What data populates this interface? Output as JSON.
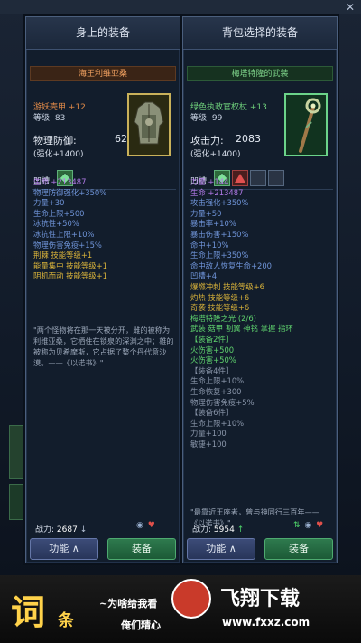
{
  "left": {
    "title": "身上的装备",
    "item_name": "海王利维亚桑",
    "item_type": "游妖壳甲 +12",
    "level": "等级: 83",
    "main_stat_label": "物理防御:",
    "main_stat_value": "6254",
    "enhance": "(强化+1400)",
    "sockets_label": "凹槽:",
    "lines": [
      {
        "text": "生命 +213487",
        "cls": "c-purple"
      },
      {
        "text": "物理防御强化+350%",
        "cls": "c-blue"
      },
      {
        "text": "力量+30",
        "cls": "c-blue"
      },
      {
        "text": "生命上限+500",
        "cls": "c-blue"
      },
      {
        "text": "冰抗性+50%",
        "cls": "c-blue"
      },
      {
        "text": "冰抗性上限+10%",
        "cls": "c-blue"
      },
      {
        "text": "物理伤害免疫+15%",
        "cls": "c-blue"
      },
      {
        "text": "荆棘 技能等级+1",
        "cls": "c-gold"
      },
      {
        "text": "能量集中 技能等级+1",
        "cls": "c-gold"
      },
      {
        "text": "阴机而动 技能等级+1",
        "cls": "c-gold"
      }
    ],
    "quote": "\"两个怪物将在那一天被分开，雌的被称为利维亚桑，它栖住在锁泉的深渊之中；雄的被称为贝希摩斯，它占据了整个丹代意沙漠。——《以诺书》\"",
    "power_label": "战力:",
    "power_value": "2687",
    "power_arrow": "↓",
    "btn_func": "功能 ∧",
    "btn_equip": "装备"
  },
  "right": {
    "title": "背包选择的装备",
    "item_name": "梅塔特隆的武装",
    "item_type": "绿色执政官权杖 +13",
    "level": "等级: 99",
    "main_stat_label": "攻击力:",
    "main_stat_value": "2083",
    "enhance": "(强化+1400)",
    "sockets_label": "凹槽:",
    "lines": [
      {
        "text": "力量 +144",
        "cls": "c-purple"
      },
      {
        "text": "生命 +213487",
        "cls": "c-purple"
      },
      {
        "text": "攻击强化+350%",
        "cls": "c-blue"
      },
      {
        "text": "力量+50",
        "cls": "c-blue"
      },
      {
        "text": "暴击率+10%",
        "cls": "c-blue"
      },
      {
        "text": "暴击伤害+150%",
        "cls": "c-blue"
      },
      {
        "text": "命中+10%",
        "cls": "c-blue"
      },
      {
        "text": "生命上限+350%",
        "cls": "c-blue"
      },
      {
        "text": "命中敌人恢复生命+200",
        "cls": "c-blue"
      },
      {
        "text": "凹槽+4",
        "cls": "c-blue"
      },
      {
        "text": "爆燃冲刺 技能等级+6",
        "cls": "c-gold"
      },
      {
        "text": "灼热 技能等级+6",
        "cls": "c-gold"
      },
      {
        "text": "奇袭 技能等级+6",
        "cls": "c-gold"
      },
      {
        "text": "梅塔特隆之光 (2/6)",
        "cls": "c-green"
      },
      {
        "text": "武装 菇甲 割翼 神铭 掌握 指环",
        "cls": "c-green"
      },
      {
        "text": "【装备2件】",
        "cls": "c-green"
      },
      {
        "text": "火伤害+500",
        "cls": "c-green"
      },
      {
        "text": "火伤害+50%",
        "cls": "c-green"
      },
      {
        "text": "【装备4件】",
        "cls": "c-grey"
      },
      {
        "text": "生命上限+10%",
        "cls": "c-grey"
      },
      {
        "text": "生命恢复+300",
        "cls": "c-grey"
      },
      {
        "text": "物理伤害免疫+5%",
        "cls": "c-grey"
      },
      {
        "text": "【装备6件】",
        "cls": "c-grey"
      },
      {
        "text": "生命上限+10%",
        "cls": "c-grey"
      },
      {
        "text": "力量+100",
        "cls": "c-grey"
      },
      {
        "text": "敏捷+100",
        "cls": "c-grey"
      }
    ],
    "quote": "\"最靠近王座者，曾与神同行三百年——《以诺书》\"",
    "power_label": "战力:",
    "power_value": "5954",
    "power_arrow": "↑",
    "btn_func": "功能 ∧",
    "btn_equip": "装备"
  },
  "topbar": {
    "close": "✕"
  },
  "banner": {
    "big_char": "词",
    "small_char": "条",
    "promo_line1": "~为啥给我看",
    "promo_line2": "俺们精心",
    "watermark_title": "飞翔下载",
    "watermark_url": "www.fxxz.com"
  }
}
